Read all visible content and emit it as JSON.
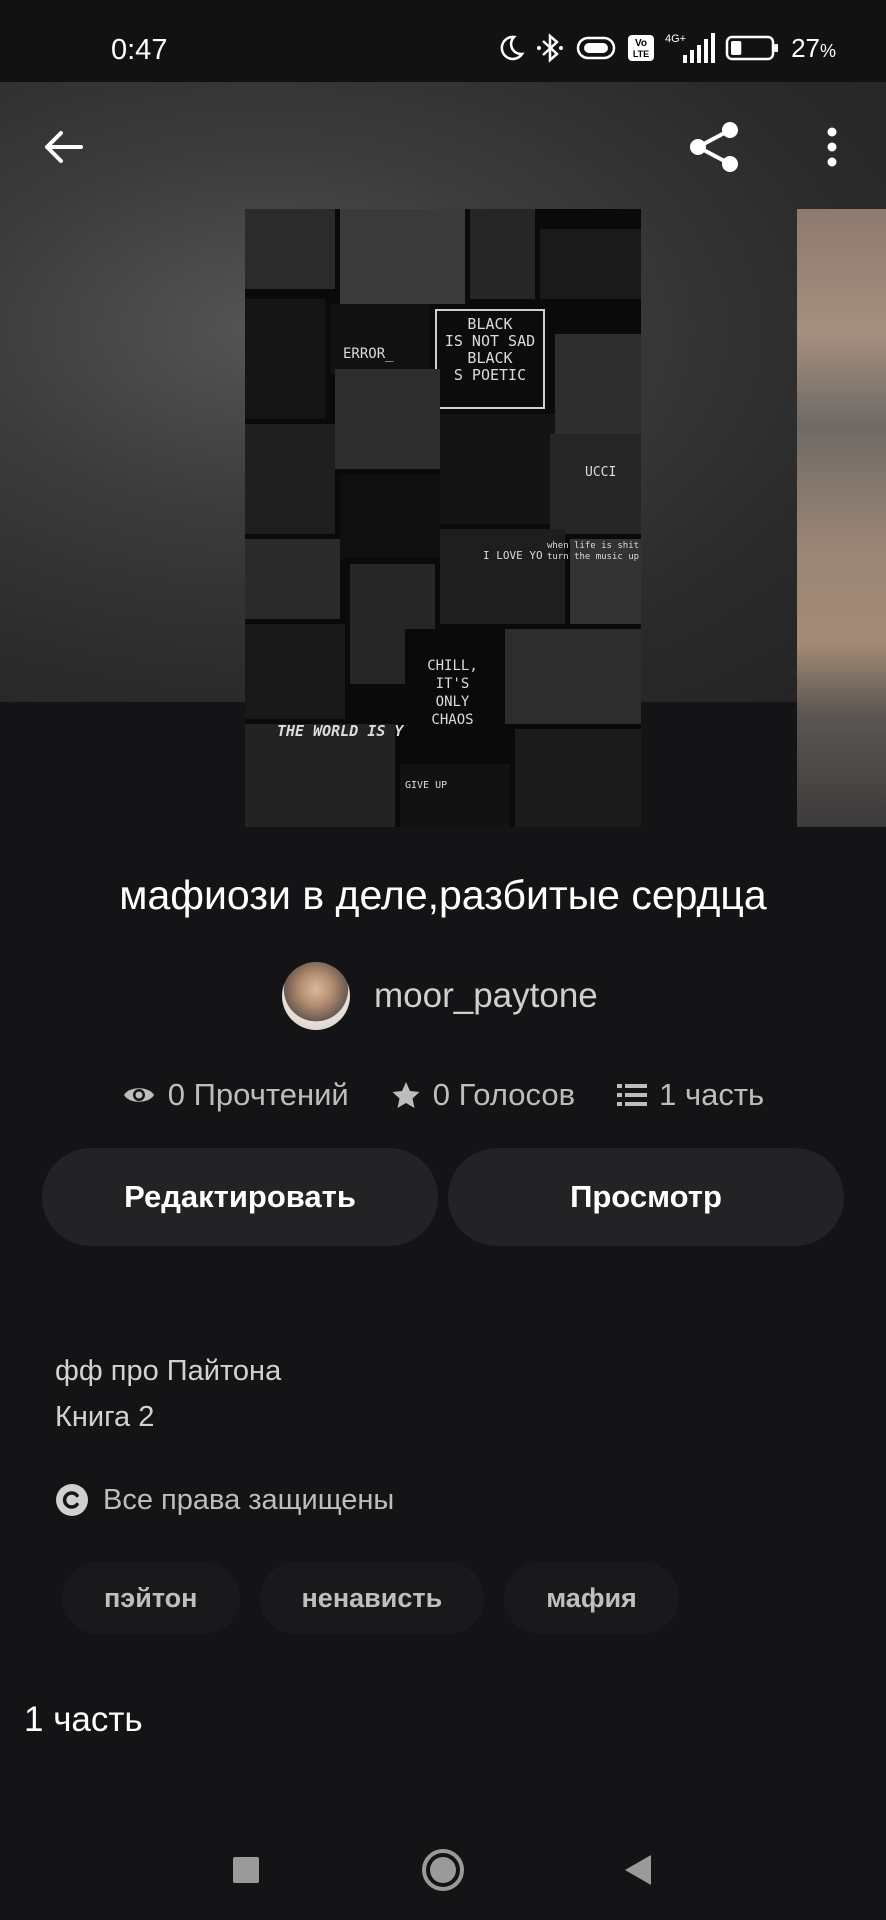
{
  "status_bar": {
    "time": "0:47",
    "network": "4G+",
    "volte": "Vo LTE",
    "battery_percent": "27",
    "battery_unit": "%",
    "battery_level": 0.27,
    "icons": [
      "moon-icon",
      "bluetooth-icon",
      "vibrate-icon",
      "volte-icon",
      "signal-icon",
      "battery-icon"
    ]
  },
  "header": {
    "back_icon": "arrow-left-icon",
    "share_icon": "share-icon",
    "more_icon": "more-vertical-icon"
  },
  "cover": {
    "texts": {
      "error": "ERROR_",
      "black_sad": "BLACK\nIS NOT SAD\nBLACK\nS POETIC",
      "love": "I LOVE YO",
      "music": "when life is shit\nturn the music up",
      "chill": "CHILL,\nIT'S\nONLY\nCHAOS",
      "world": "THE WORLD IS Y",
      "give_up": "GIVE UP",
      "gucci": "UCCI"
    }
  },
  "book": {
    "title": "мафиози в деле,разбитые сердца",
    "author": "moor_paytone"
  },
  "stats": {
    "reads": "0 Прочтений",
    "votes": "0 Голосов",
    "parts": "1 часть"
  },
  "actions": {
    "edit": "Редактировать",
    "view": "Просмотр"
  },
  "description": {
    "line1": "фф про Пайтона",
    "line2": "Книга 2"
  },
  "rights": "Все права защищены",
  "tags": [
    "пэйтон",
    "ненависть",
    "мафия"
  ],
  "parts_section_label": "1 часть",
  "colors": {
    "background": "#141316",
    "button_bg": "#232225",
    "tag_bg": "#19181b"
  }
}
